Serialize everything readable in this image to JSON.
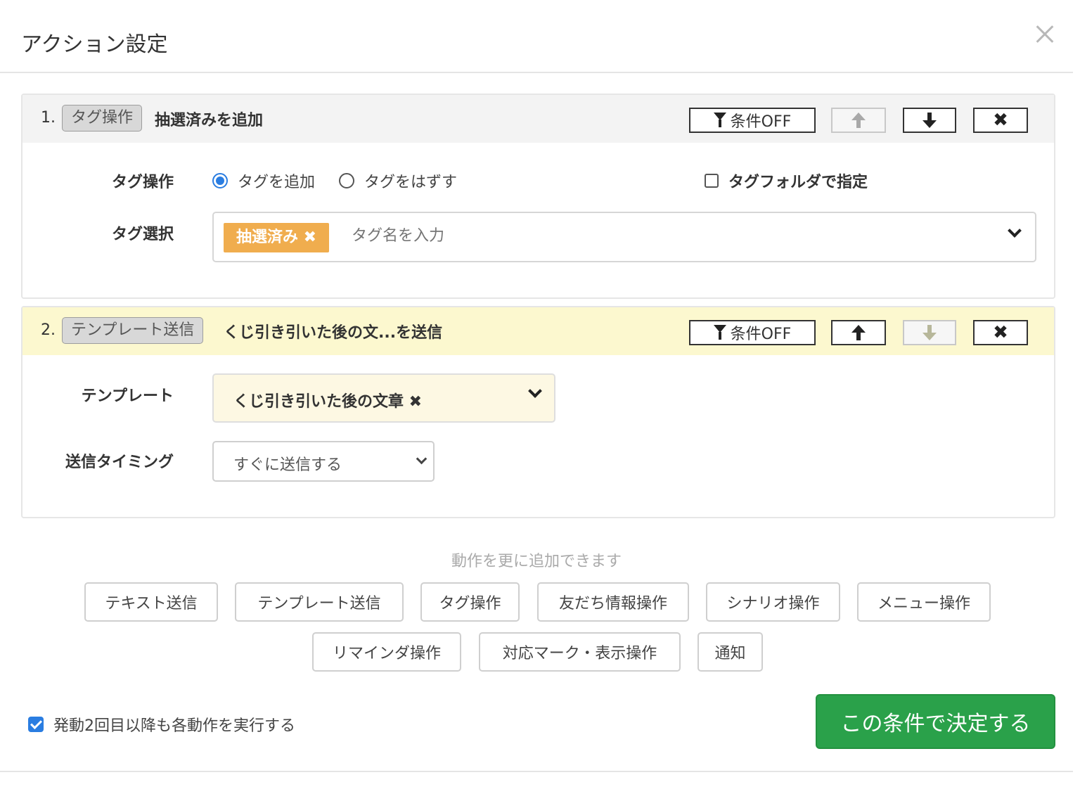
{
  "modal": {
    "title": "アクション設定",
    "close_icon": "close-icon"
  },
  "actions": [
    {
      "number": "1.",
      "type_badge": "タグ操作",
      "summary": "抽選済みを追加",
      "header_bg": "#f3f3f3",
      "condition_label": "条件OFF",
      "up_enabled": false,
      "down_enabled": true,
      "fields": {
        "tag_op_label": "タグ操作",
        "radio_add": "タグを追加",
        "radio_remove": "タグをはずす",
        "selected_radio": "add",
        "folder_check_label": "タグフォルダで指定",
        "folder_checked": false,
        "tag_select_label": "タグ選択",
        "selected_tag": "抽選済み ✖",
        "tag_placeholder": "タグ名を入力",
        "tag_color": "#f0ad4e"
      }
    },
    {
      "number": "2.",
      "type_badge": "テンプレート送信",
      "summary": "くじ引き引いた後の文...を送信",
      "header_bg": "#fcf8cf",
      "condition_label": "条件OFF",
      "up_enabled": true,
      "down_enabled": false,
      "fields": {
        "template_label": "テンプレート",
        "template_value": "くじ引き引いた後の文章 ✖",
        "timing_label": "送信タイミング",
        "timing_value": "すぐに送信する"
      }
    }
  ],
  "add_section": {
    "hint": "動作を更に追加できます",
    "buttons": [
      "テキスト送信",
      "テンプレート送信",
      "タグ操作",
      "友だち情報操作",
      "シナリオ操作",
      "メニュー操作",
      "リマインダ操作",
      "対応マーク・表示操作",
      "通知"
    ]
  },
  "footer": {
    "repeat_label": "発動2回目以降も各動作を実行する",
    "repeat_checked": true,
    "submit_label": "この条件で決定する",
    "submit_color": "#2aa14a"
  }
}
